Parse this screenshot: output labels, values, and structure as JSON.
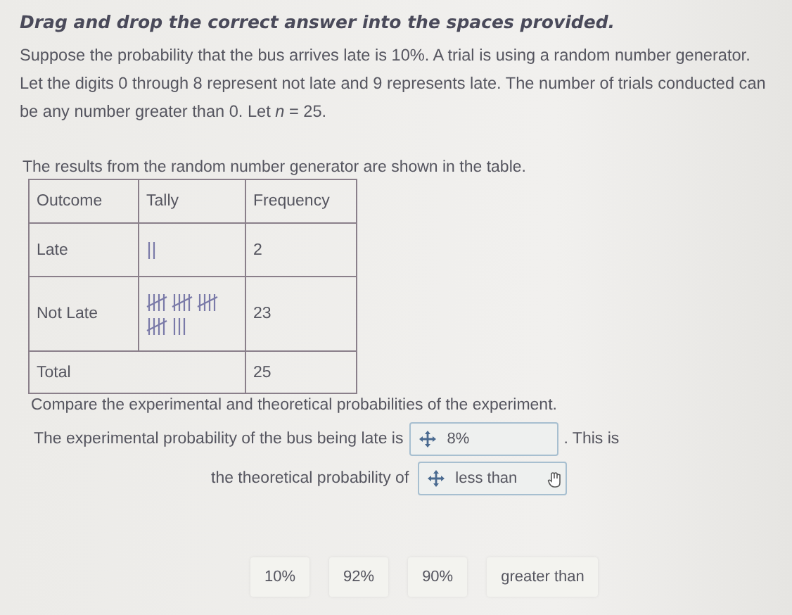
{
  "instruction": "Drag and drop the correct answer into the spaces provided.",
  "problem": "Suppose the probability that the bus arrives late is 10%. A trial is using a random number generator. Let the digits 0 through 8 represent not late and 9 represents late. The number of trials conducted can be any number greater than 0. Let *n* = 25.",
  "table_intro": "The results from the random number generator are shown in the table.",
  "table": {
    "columns": [
      "Outcome",
      "Tally",
      "Frequency"
    ],
    "rows": [
      {
        "outcome": "Late",
        "frequency": "2"
      },
      {
        "outcome": "Not Late",
        "frequency": "23"
      }
    ],
    "total": {
      "label": "Total",
      "frequency": "25"
    }
  },
  "prompt": "Compare the experimental and theoretical probabilities of the experiment.",
  "sentence": {
    "part_1": "The experimental probability of the bus being late is",
    "blank_1": "8%",
    "part_2": ". This is",
    "part_3": "the theoretical probability of",
    "blank_2": "less than"
  },
  "answer_tiles": [
    "10%",
    "92%",
    "90%",
    "greater than"
  ]
}
